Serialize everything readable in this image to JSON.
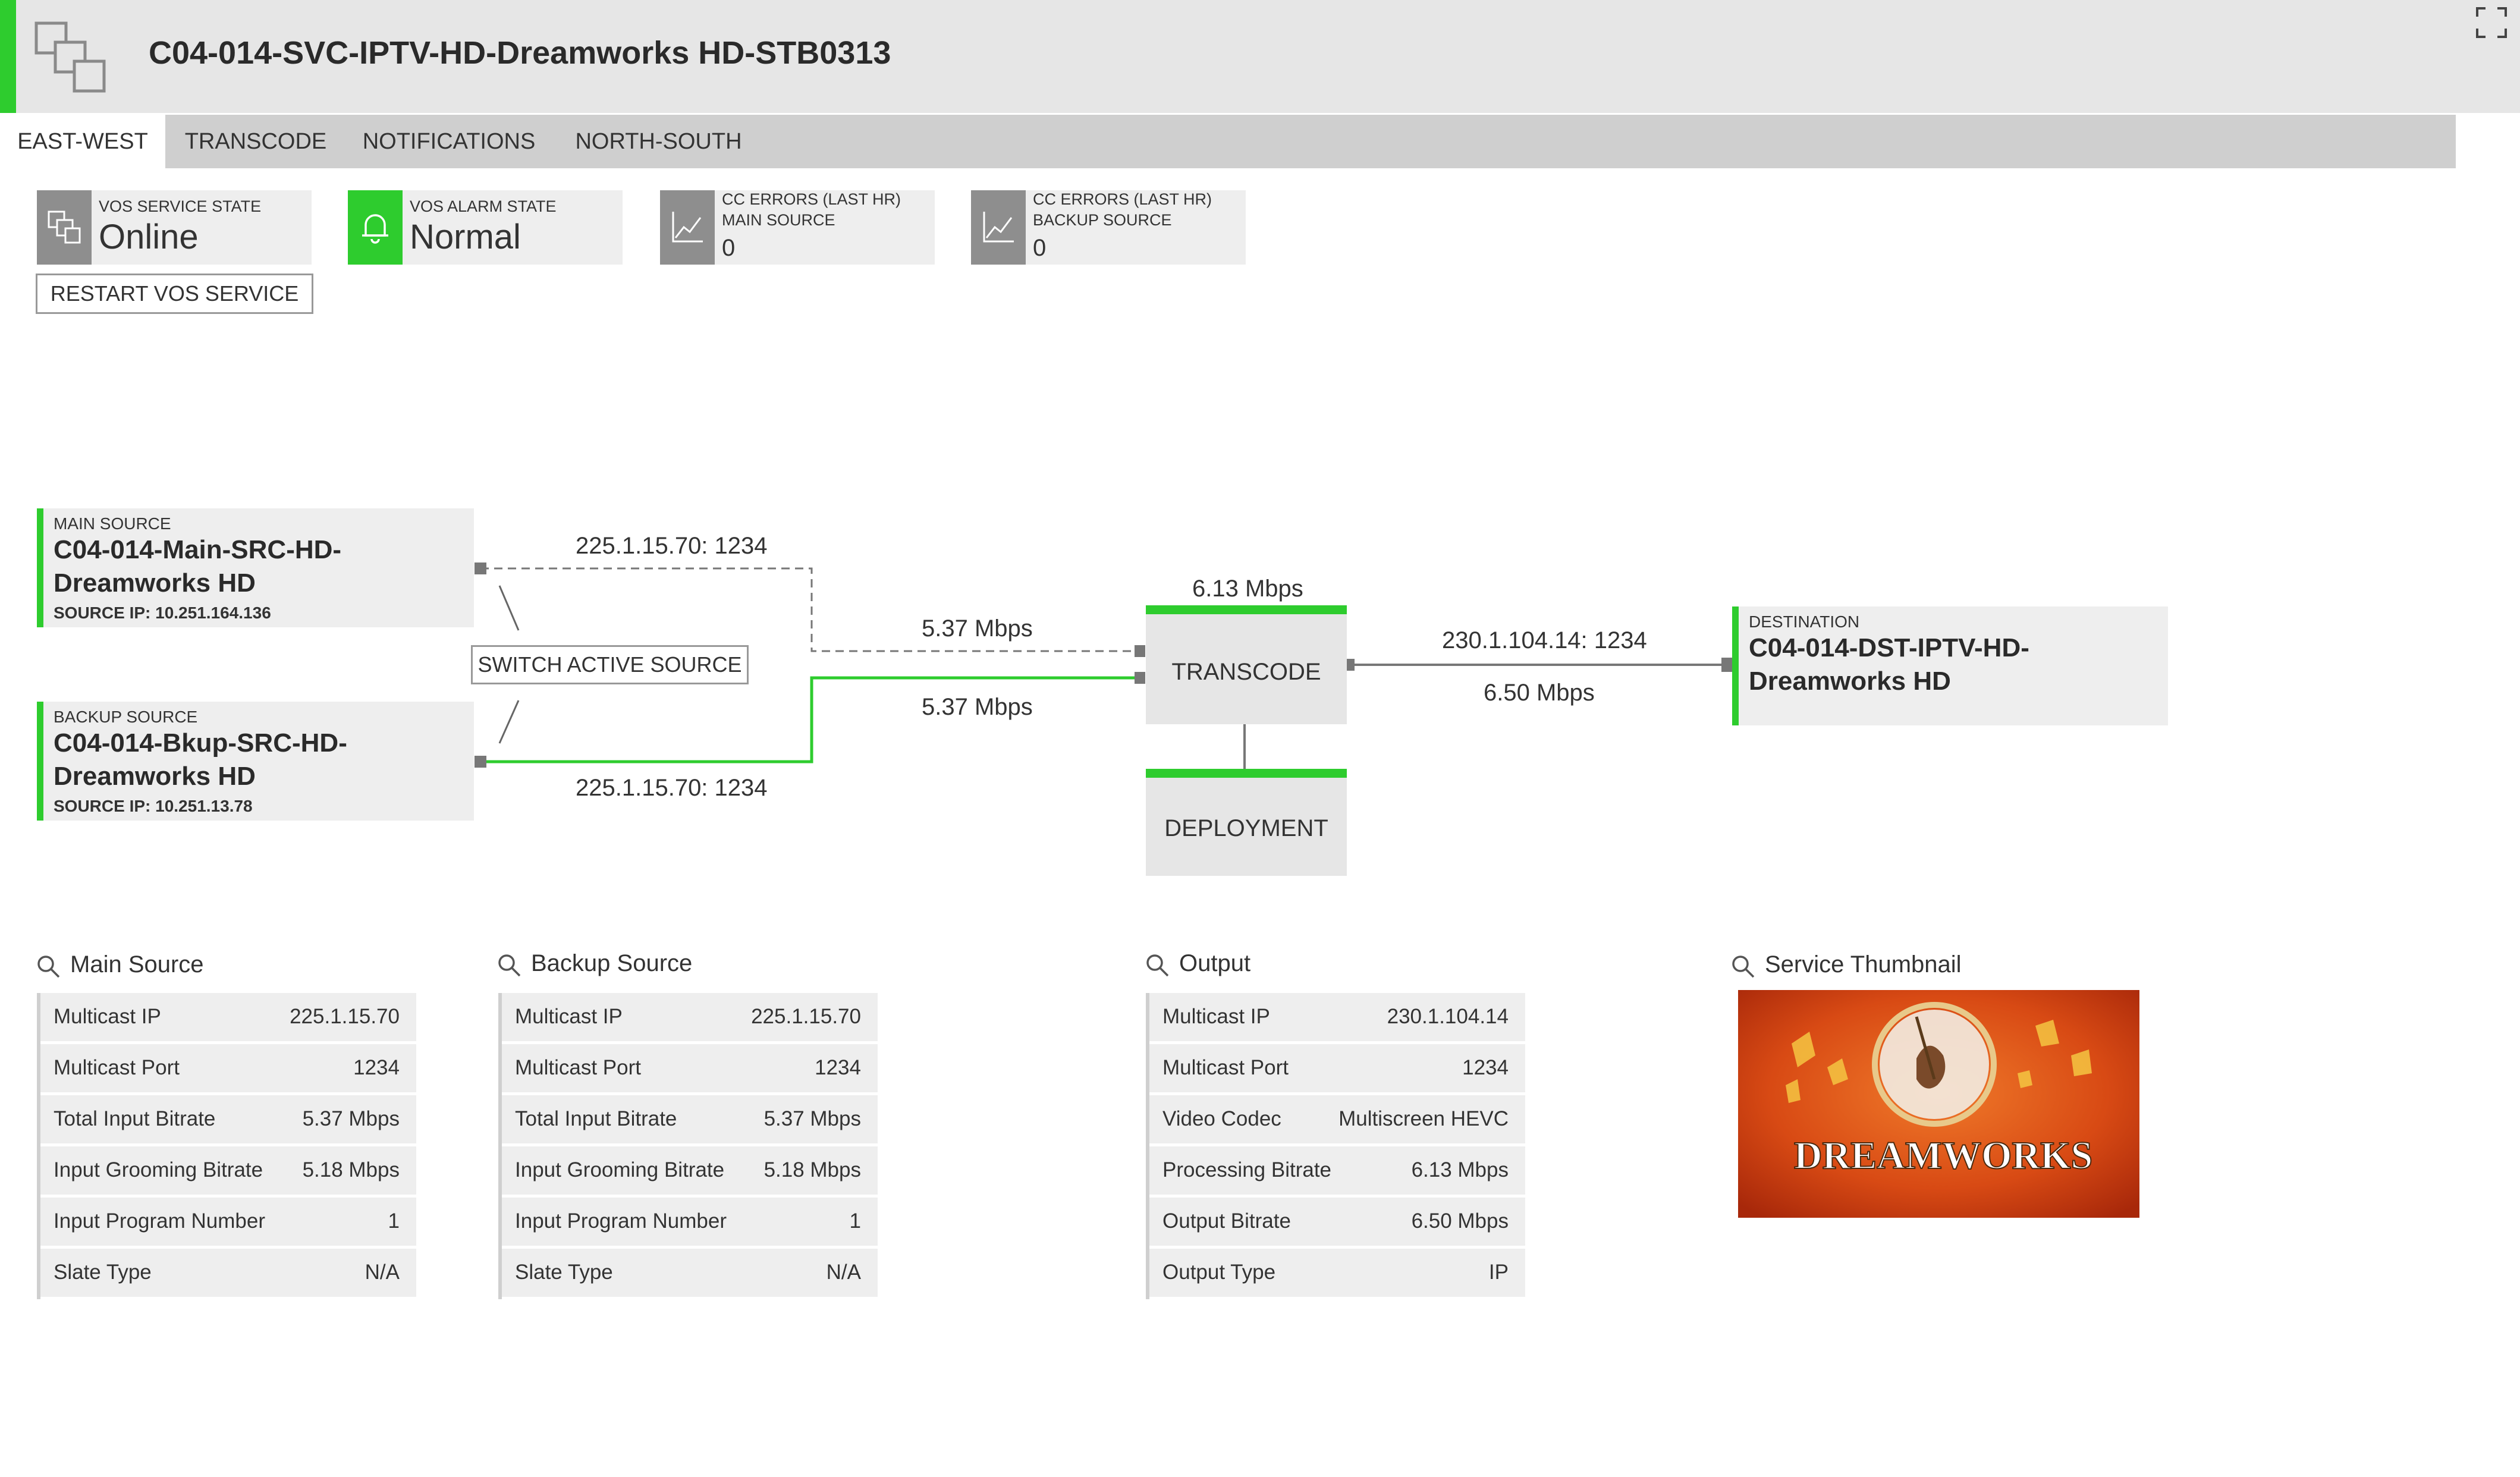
{
  "colors": {
    "accent": "#2ecc2e",
    "title_bar": "#e6e6e6",
    "tab_bar": "#cfcfcf",
    "card": "#eeeeee"
  },
  "header": {
    "title": "C04-014-SVC-IPTV-HD-Dreamworks HD-STB0313",
    "icon": "service-icon"
  },
  "tabs": [
    {
      "label": "EAST-WEST",
      "active": true
    },
    {
      "label": "TRANSCODE",
      "active": false
    },
    {
      "label": "NOTIFICATIONS",
      "active": false
    },
    {
      "label": "NORTH-SOUTH",
      "active": false
    }
  ],
  "status": {
    "service_state": {
      "label": "VOS SERVICE STATE",
      "value": "Online",
      "icon": "service-icon"
    },
    "alarm_state": {
      "label": "VOS ALARM STATE",
      "value": "Normal",
      "icon": "bell-icon"
    },
    "cc_main": {
      "label1": "CC ERRORS (LAST HR)",
      "label2": "MAIN SOURCE",
      "value": "0",
      "icon": "chart-icon"
    },
    "cc_backup": {
      "label1": "CC ERRORS (LAST HR)",
      "label2": "BACKUP SOURCE",
      "value": "0",
      "icon": "chart-icon"
    },
    "restart_label": "RESTART VOS SERVICE"
  },
  "diagram": {
    "main_source": {
      "label": "MAIN SOURCE",
      "name": "C04-014-Main-SRC-HD-Dreamworks HD",
      "ip": "SOURCE IP: 10.251.164.136"
    },
    "backup_source": {
      "label": "BACKUP SOURCE",
      "name": "C04-014-Bkup-SRC-HD-Dreamworks HD",
      "ip": "SOURCE IP: 10.251.13.78"
    },
    "switch_label": "SWITCH ACTIVE SOURCE",
    "main_addr": "225.1.15.70: 1234",
    "backup_addr": "225.1.15.70: 1234",
    "main_rate": "5.37 Mbps",
    "backup_rate": "5.37 Mbps",
    "transcode_rate": "6.13 Mbps",
    "transcode_label": "TRANSCODE",
    "deployment_label": "DEPLOYMENT",
    "output_addr": "230.1.104.14: 1234",
    "output_rate": "6.50 Mbps",
    "destination": {
      "label": "DESTINATION",
      "name": "C04-014-DST-IPTV-HD-Dreamworks HD"
    }
  },
  "panels": {
    "main_source": {
      "title": "Main Source",
      "rows": [
        {
          "k": "Multicast IP",
          "v": "225.1.15.70"
        },
        {
          "k": "Multicast Port",
          "v": "1234"
        },
        {
          "k": "Total Input Bitrate",
          "v": "5.37 Mbps"
        },
        {
          "k": "Input Grooming Bitrate",
          "v": "5.18 Mbps"
        },
        {
          "k": "Input Program Number",
          "v": "1"
        },
        {
          "k": "Slate Type",
          "v": "N/A"
        }
      ]
    },
    "backup_source": {
      "title": "Backup Source",
      "rows": [
        {
          "k": "Multicast IP",
          "v": "225.1.15.70"
        },
        {
          "k": "Multicast Port",
          "v": "1234"
        },
        {
          "k": "Total Input Bitrate",
          "v": "5.37 Mbps"
        },
        {
          "k": "Input Grooming Bitrate",
          "v": "5.18 Mbps"
        },
        {
          "k": "Input Program Number",
          "v": "1"
        },
        {
          "k": "Slate Type",
          "v": "N/A"
        }
      ]
    },
    "output": {
      "title": "Output",
      "rows": [
        {
          "k": "Multicast IP",
          "v": "230.1.104.14"
        },
        {
          "k": "Multicast Port",
          "v": "1234"
        },
        {
          "k": "Video Codec",
          "v": "Multiscreen HEVC"
        },
        {
          "k": "Processing Bitrate",
          "v": "6.13 Mbps"
        },
        {
          "k": "Output Bitrate",
          "v": "6.50 Mbps"
        },
        {
          "k": "Output Type",
          "v": "IP"
        }
      ]
    },
    "thumbnail": {
      "title": "Service Thumbnail",
      "logo_text": "DREAMWORKS"
    }
  }
}
